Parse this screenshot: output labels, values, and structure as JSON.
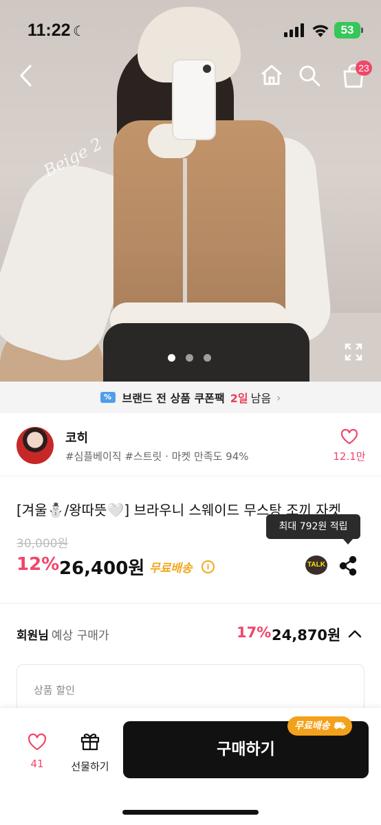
{
  "status_bar": {
    "time": "11:22",
    "battery": "53"
  },
  "nav": {
    "cart_count": "23"
  },
  "hero": {
    "image_text": "Beige 2",
    "page_dots": 3,
    "active_dot": 1
  },
  "coupon_banner": {
    "text": "브랜드 전 상품 쿠폰팩",
    "highlight": "2일",
    "rest": "남음"
  },
  "seller": {
    "name": "코히",
    "tags": "#심플베이직 #스트릿 · 마켓 만족도 94%",
    "likes": "12.1만"
  },
  "product": {
    "title": "[겨울⛄/왕따뜻🤍] 브라우니 스웨이드 무스탕 조끼 자켓",
    "tooltip": "최대 792원 적립",
    "original_price": "30,000원",
    "discount": "12%",
    "price": "26,400원",
    "shipping": "무료배송",
    "talk_label": "TALK"
  },
  "member_price": {
    "label_bold": "회원님",
    "label_rest": "예상 구매가",
    "discount": "17%",
    "price": "24,870원"
  },
  "discount_box": {
    "label": "상품 할인"
  },
  "bottom_bar": {
    "likes": "41",
    "gift_label": "선물하기",
    "buy_label": "구매하기",
    "free_badge": "무료배송"
  },
  "colors": {
    "accent_pink": "#f0466a",
    "shipping_orange": "#f2a51a",
    "buy_button": "#111111"
  }
}
